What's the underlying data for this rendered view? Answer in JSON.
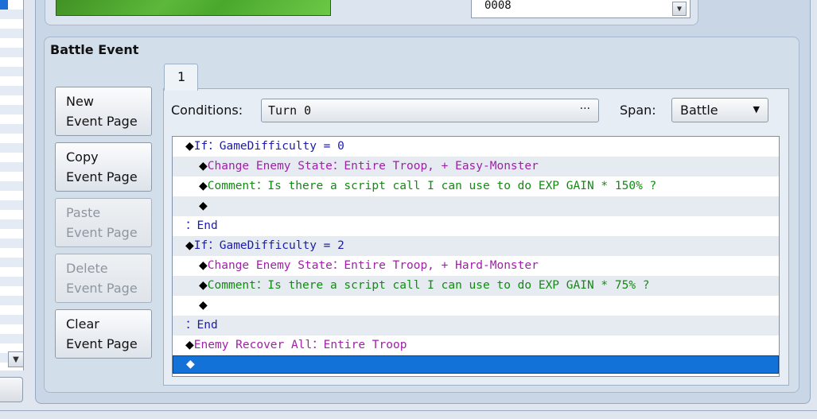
{
  "top": {
    "troop_id": "0008"
  },
  "battle_event": {
    "title": "Battle Event",
    "buttons": [
      {
        "line1": "New",
        "line2": "Event Page",
        "enabled": true
      },
      {
        "line1": "Copy",
        "line2": "Event Page",
        "enabled": true
      },
      {
        "line1": "Paste",
        "line2": "Event Page",
        "enabled": false
      },
      {
        "line1": "Delete",
        "line2": "Event Page",
        "enabled": false
      },
      {
        "line1": "Clear",
        "line2": "Event Page",
        "enabled": true
      }
    ],
    "tabs": [
      {
        "label": "1"
      }
    ],
    "conditions_label": "Conditions:",
    "conditions_value": "Turn 0",
    "conditions_button": "···",
    "span_label": "Span:",
    "span_value": "Battle",
    "commands": [
      {
        "indent": 0,
        "marker": "◆",
        "text": "If：GameDifficulty = 0",
        "color": "#1c1ca8"
      },
      {
        "indent": 1,
        "marker": "◆",
        "text": "Change Enemy State：Entire Troop, + Easy-Monster",
        "color": "#a020a8"
      },
      {
        "indent": 1,
        "marker": "◆",
        "text": "Comment：Is there a script call I can use to do EXP GAIN * 150% ?",
        "color": "#138a13"
      },
      {
        "indent": 1,
        "marker": "◆",
        "text": "",
        "color": "#000000"
      },
      {
        "indent": 0,
        "marker": "",
        "text": "：End",
        "color": "#1c1ca8"
      },
      {
        "indent": 0,
        "marker": "◆",
        "text": "If：GameDifficulty = 2",
        "color": "#1c1ca8"
      },
      {
        "indent": 1,
        "marker": "◆",
        "text": "Change Enemy State：Entire Troop, + Hard-Monster",
        "color": "#a020a8"
      },
      {
        "indent": 1,
        "marker": "◆",
        "text": "Comment：Is there a script call I can use to do EXP GAIN * 75% ?",
        "color": "#138a13"
      },
      {
        "indent": 1,
        "marker": "◆",
        "text": "",
        "color": "#000000"
      },
      {
        "indent": 0,
        "marker": "",
        "text": "：End",
        "color": "#1c1ca8"
      },
      {
        "indent": 0,
        "marker": "◆",
        "text": "Enemy Recover All：Entire Troop",
        "color": "#a020a8"
      },
      {
        "indent": 0,
        "marker": "◆",
        "text": "",
        "color": "#ffffff",
        "selected": true
      }
    ]
  },
  "icons": {
    "scroll_down": "▼",
    "dropdown": "▼"
  }
}
